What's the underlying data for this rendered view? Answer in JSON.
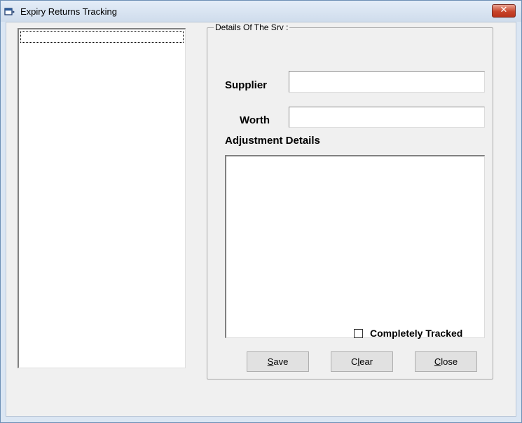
{
  "window": {
    "title": "Expiry Returns Tracking",
    "close_glyph": "✕",
    "icon": "app-window-icon"
  },
  "groupbox": {
    "legend": "Details Of The Srv :"
  },
  "form": {
    "supplier_label": "Supplier",
    "supplier_value": "",
    "worth_label": "Worth",
    "worth_value": "",
    "adjustment_label": "Adjustment Details",
    "adjustment_value": "",
    "completely_tracked_label": "Completely Tracked",
    "completely_tracked_checked": false
  },
  "buttons": {
    "save": {
      "mnemonic": "S",
      "rest": "ave"
    },
    "clear": {
      "before": "C",
      "mnemonic": "l",
      "rest": "ear"
    },
    "close": {
      "mnemonic": "C",
      "rest": "lose"
    }
  },
  "list": {
    "items": []
  },
  "colors": {
    "titlebar": "#dbe6f3",
    "client_bg": "#f0f0f0",
    "close_button": "#c8442b"
  }
}
